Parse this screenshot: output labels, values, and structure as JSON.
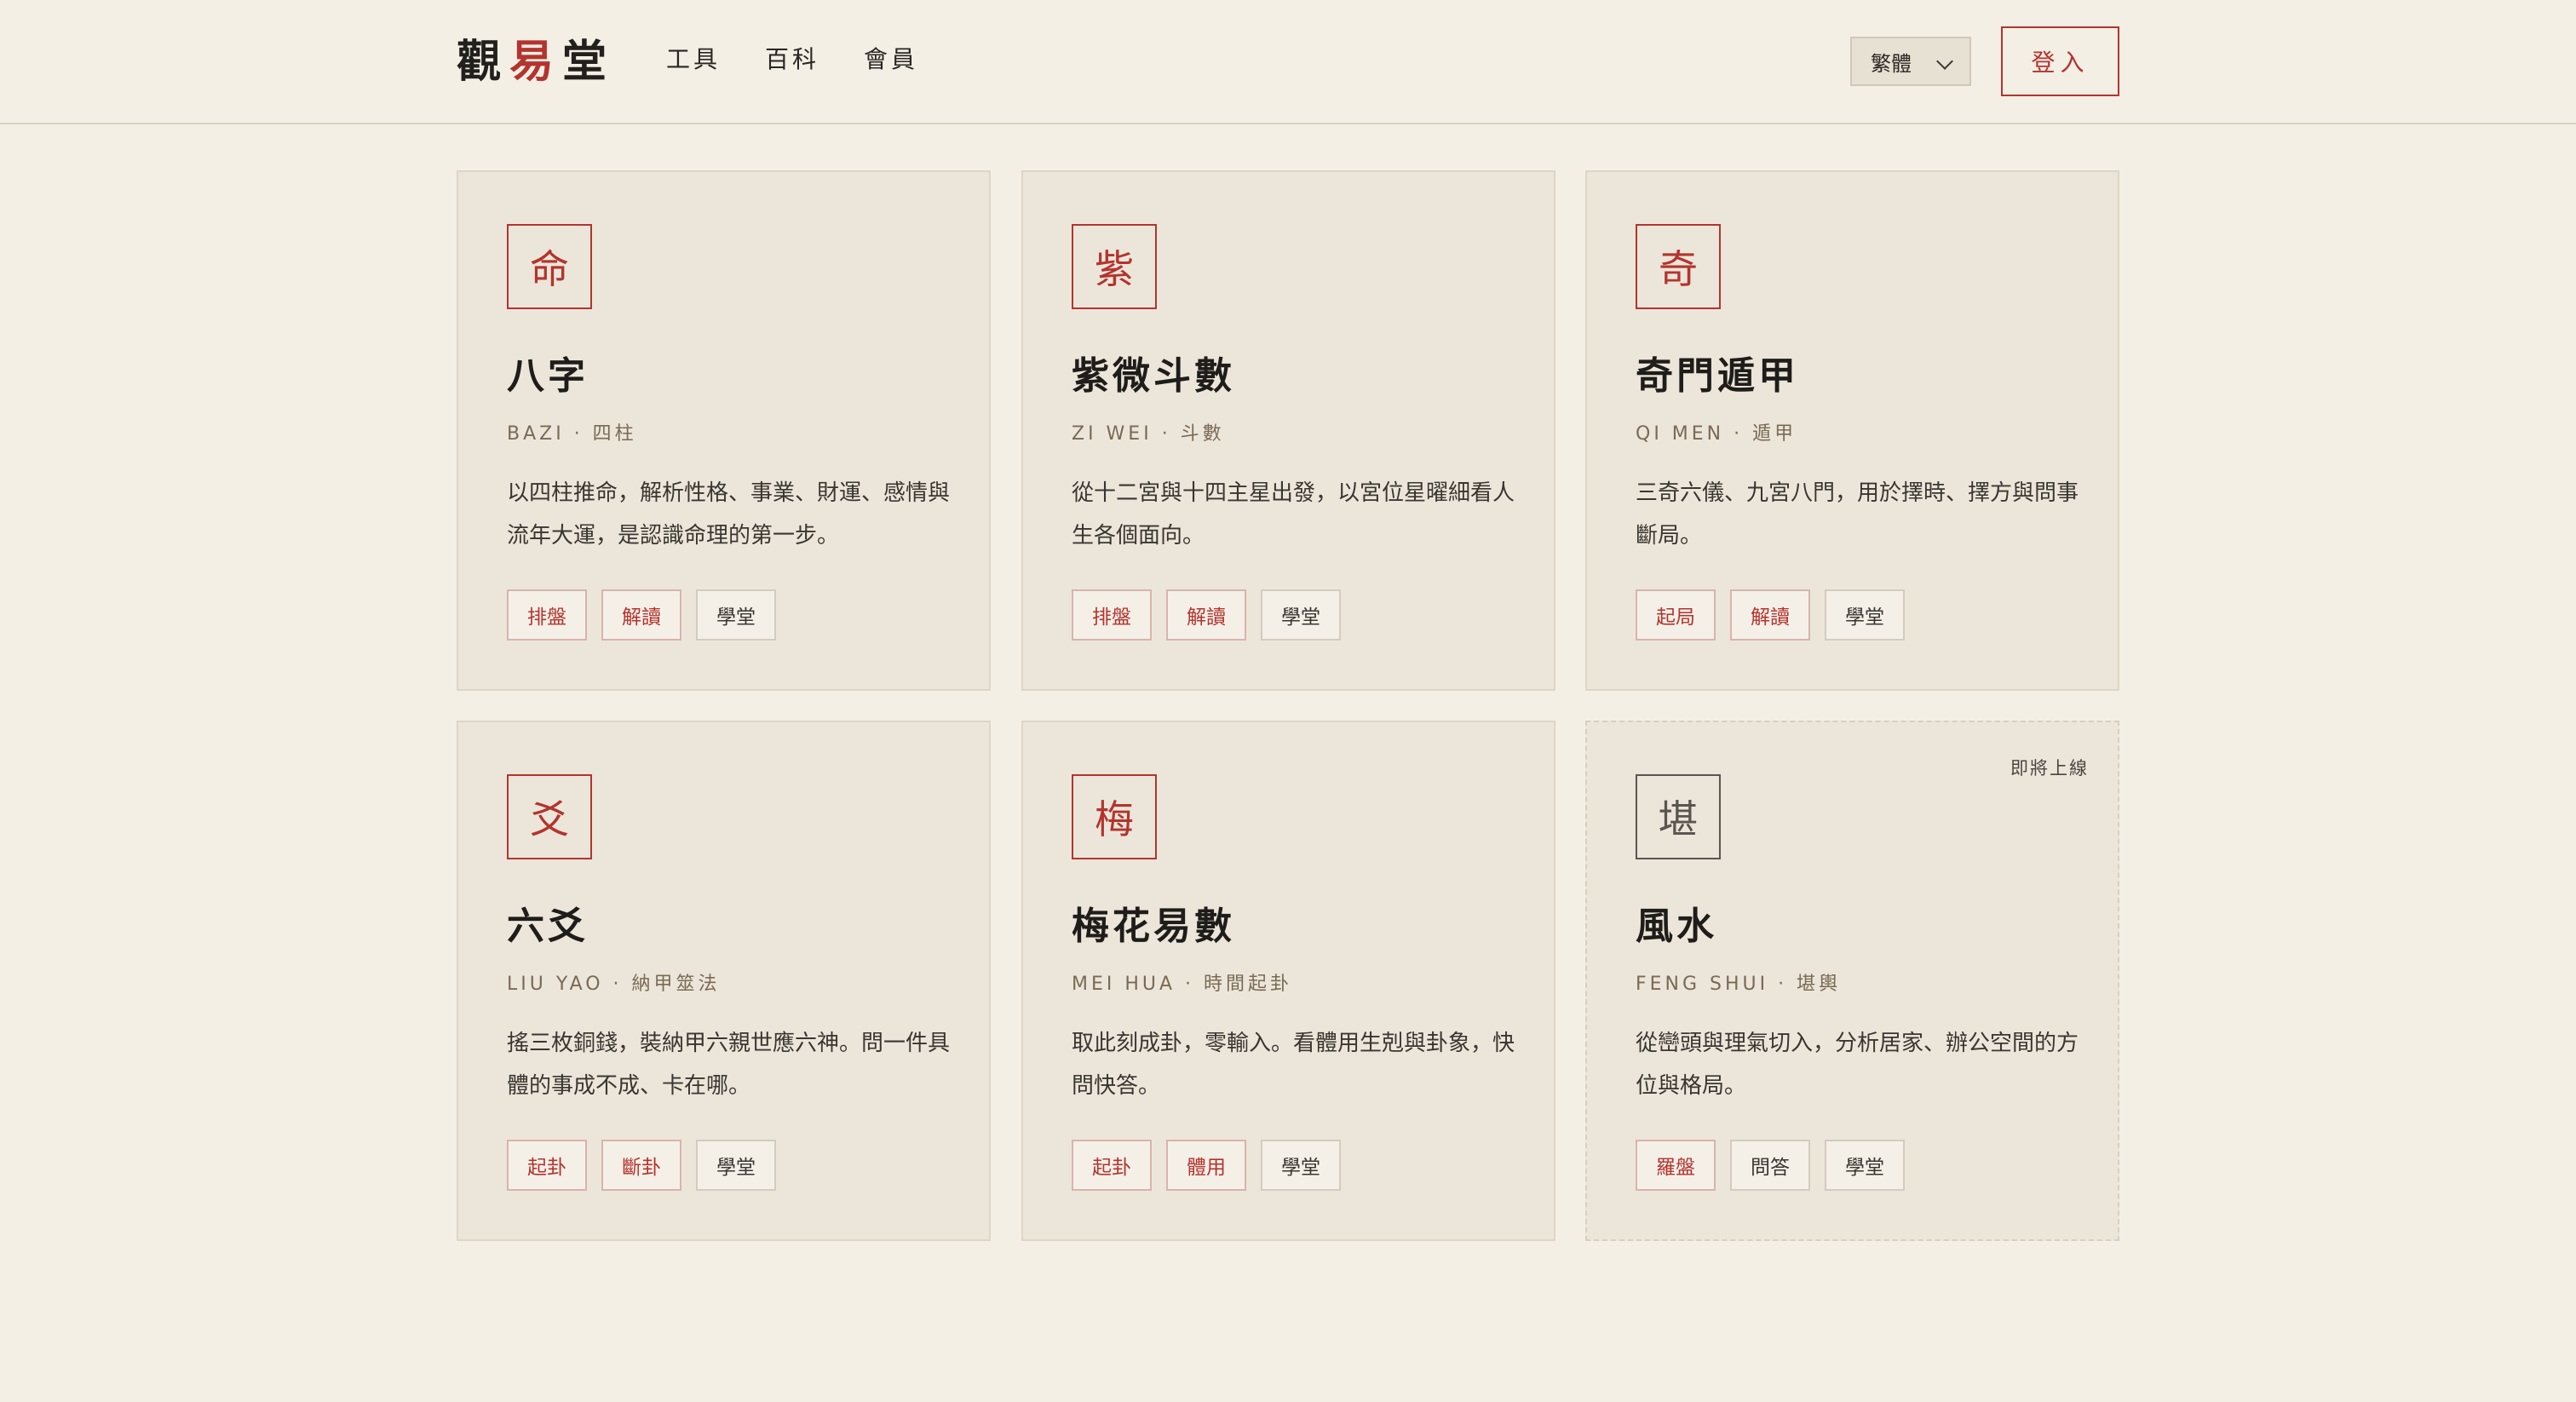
{
  "header": {
    "logo_chars": [
      "觀",
      "易",
      "堂"
    ],
    "nav": [
      "工具",
      "百科",
      "會員"
    ],
    "language": "繁體",
    "login_label": "登入"
  },
  "colors": {
    "accent": "#b3342e",
    "background": "#f3efe5",
    "card_bg": "#ece6da"
  },
  "cards": [
    {
      "glyph": "命",
      "title": "八字",
      "sub": "BAZI · 四柱",
      "desc": "以四柱推命，解析性格、事業、財運、感情與流年大運，是認識命理的第一步。",
      "buttons": [
        "排盤",
        "解讀",
        "學堂"
      ],
      "primary_buttons": [
        0,
        1
      ],
      "badge": ""
    },
    {
      "glyph": "紫",
      "title": "紫微斗數",
      "sub": "ZI WEI · 斗數",
      "desc": "從十二宮與十四主星出發，以宮位星曜細看人生各個面向。",
      "buttons": [
        "排盤",
        "解讀",
        "學堂"
      ],
      "primary_buttons": [
        0,
        1
      ],
      "badge": ""
    },
    {
      "glyph": "奇",
      "title": "奇門遁甲",
      "sub": "QI MEN · 遁甲",
      "desc": "三奇六儀、九宮八門，用於擇時、擇方與問事斷局。",
      "buttons": [
        "起局",
        "解讀",
        "學堂"
      ],
      "primary_buttons": [
        0,
        1
      ],
      "badge": ""
    },
    {
      "glyph": "爻",
      "title": "六爻",
      "sub": "LIU YAO · 納甲筮法",
      "desc": "搖三枚銅錢，裝納甲六親世應六神。問一件具體的事成不成、卡在哪。",
      "buttons": [
        "起卦",
        "斷卦",
        "學堂"
      ],
      "primary_buttons": [
        0,
        1
      ],
      "badge": ""
    },
    {
      "glyph": "梅",
      "title": "梅花易數",
      "sub": "MEI HUA · 時間起卦",
      "desc": "取此刻成卦，零輸入。看體用生剋與卦象，快問快答。",
      "buttons": [
        "起卦",
        "體用",
        "學堂"
      ],
      "primary_buttons": [
        0,
        1
      ],
      "badge": ""
    },
    {
      "glyph": "堪",
      "title": "風水",
      "sub": "FENG SHUI · 堪輿",
      "desc": "從巒頭與理氣切入，分析居家、辦公空間的方位與格局。",
      "buttons": [
        "羅盤",
        "問答",
        "學堂"
      ],
      "primary_buttons": [
        0
      ],
      "badge": "即將上線"
    }
  ]
}
